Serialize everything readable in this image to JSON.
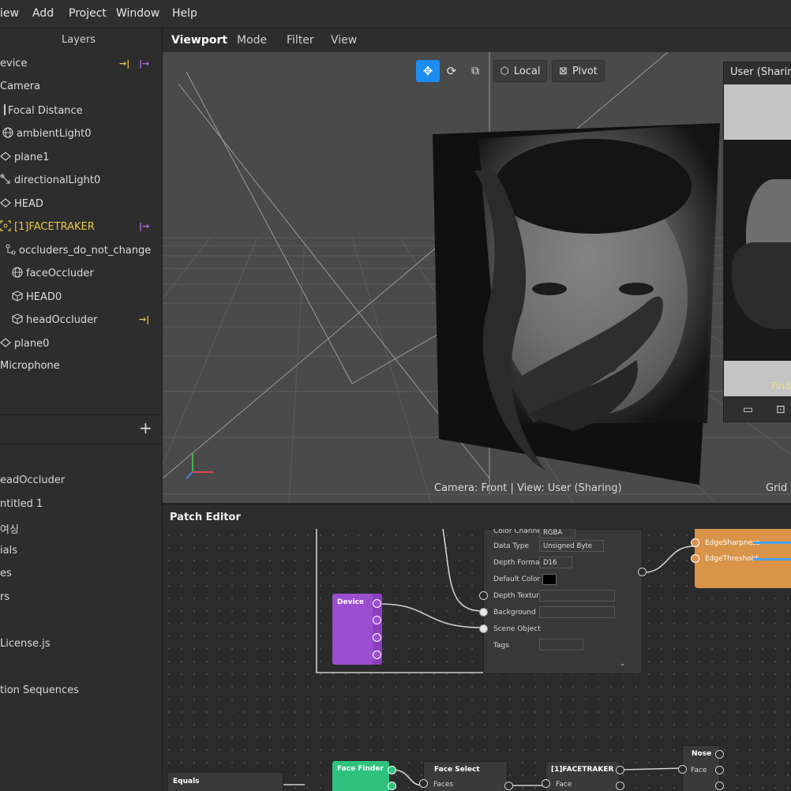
{
  "menu": {
    "items": [
      "iew",
      "Add",
      "Project",
      "Window",
      "Help"
    ]
  },
  "layers": {
    "tab_label": "Layers",
    "items": [
      {
        "label": "evice",
        "icon": "device-icon"
      },
      {
        "label": "Camera",
        "icon": "camera-icon"
      },
      {
        "label": "Focal Distance",
        "icon": "focal-distance-icon"
      },
      {
        "label": "ambientLight0",
        "icon": "ambient-light-icon"
      },
      {
        "label": "plane1",
        "icon": "plane-icon"
      },
      {
        "label": "directionalLight0",
        "icon": "directional-light-icon"
      },
      {
        "label": "HEAD",
        "icon": "plane-icon"
      },
      {
        "label": "[1]FACETRAKER",
        "icon": "face-tracker-icon"
      },
      {
        "label": "occluders_do_not_change",
        "icon": "null-object-icon"
      },
      {
        "label": "faceOccluder",
        "icon": "mesh-icon"
      },
      {
        "label": "HEAD0",
        "icon": "cube-icon"
      },
      {
        "label": "headOccluder",
        "icon": "cube-icon"
      },
      {
        "label": "plane0",
        "icon": "plane-icon"
      },
      {
        "label": "Microphone",
        "icon": "microphone-icon"
      }
    ]
  },
  "assets": {
    "add_label": "+",
    "items": [
      "eadOccluder",
      "ntitled 1",
      "여싱",
      "ials",
      "es",
      "rs",
      "License.js",
      "tion Sequences"
    ]
  },
  "viewport": {
    "tabs": [
      "Viewport",
      "Mode",
      "Filter",
      "View"
    ],
    "toolbar": {
      "move_icon": "move-icon",
      "rotate_icon": "rotate-icon",
      "scale_icon": "scale-icon",
      "local_label": "Local",
      "pivot_label": "Pivot"
    },
    "camera_status": "Camera: Front | View: User (Sharing)",
    "grid_status": "Grid s",
    "simulator": {
      "title": "User (Sharing",
      "overlay_text": "Find"
    }
  },
  "patch_editor": {
    "title": "Patch Editor",
    "texture_node": {
      "rows": [
        {
          "label": "Color Channel",
          "value": "RGBA"
        },
        {
          "label": "Data Type",
          "value": "Unsigned Byte"
        },
        {
          "label": "Depth Format",
          "value": "D16"
        },
        {
          "label": "Default Color",
          "value": ""
        },
        {
          "label": "Depth Texture",
          "value": ""
        },
        {
          "label": "Background",
          "value": ""
        },
        {
          "label": "Scene Object",
          "value": ""
        },
        {
          "label": "Tags",
          "value": ""
        }
      ]
    },
    "edge_node": {
      "rows": [
        "EdgeSharpness",
        "EdgeThreshold"
      ]
    },
    "device_node": {
      "title": "Device"
    },
    "equals_node": {
      "title": "Equals"
    },
    "face_finder_node": {
      "title": "Face Finder"
    },
    "face_select_node": {
      "title": "Face Select",
      "input": "Faces"
    },
    "facetraker_node": {
      "title": "[1]FACETRAKER",
      "input": "Face"
    },
    "nose_node": {
      "title": "Nose",
      "input": "Face"
    }
  },
  "colors": {
    "accent_blue": "#1d8cf0",
    "device_purple": "#9b4fd0",
    "edge_orange": "#d9944a",
    "face_finder_green": "#2ec27e",
    "highlight_yellow": "#e6c84a"
  }
}
